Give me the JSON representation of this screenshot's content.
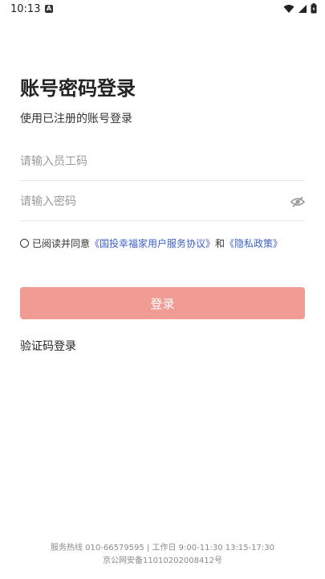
{
  "status_bar": {
    "time": "10:13",
    "notification_icon": "A"
  },
  "login": {
    "title": "账号密码登录",
    "subtitle": "使用已注册的账号登录",
    "username_placeholder": "请输入员工码",
    "password_placeholder": "请输入密码",
    "agreement": {
      "prefix": "已阅读并同意",
      "terms_link": "《国投幸福家用户服务协议》",
      "and": "和",
      "privacy_link": "《隐私政策》"
    },
    "submit_label": "登录",
    "code_login_label": "验证码登录"
  },
  "footer": {
    "line1": "服务热线 010-66579595 | 工作日 9:00-11:30 13:15-17:30",
    "line2": "京公网安备11010202008412号"
  },
  "colors": {
    "button_bg": "#f09c94",
    "link": "#3a5fc9"
  }
}
